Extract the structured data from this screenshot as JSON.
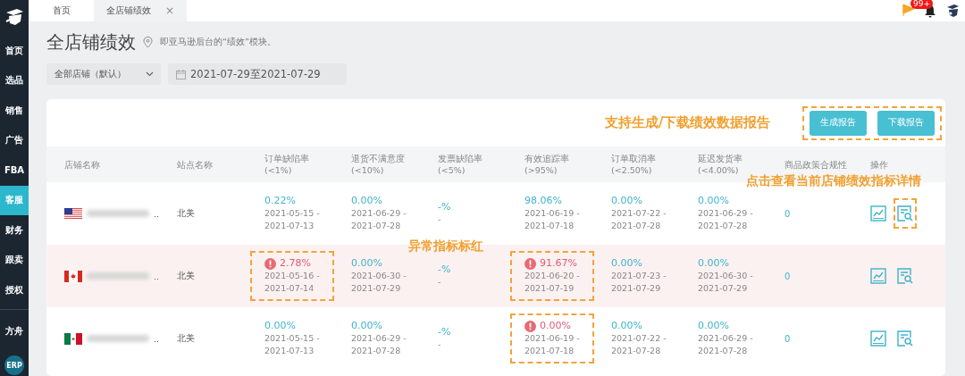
{
  "sidebar": {
    "items": [
      {
        "label": "首页",
        "selected": false
      },
      {
        "label": "选品",
        "selected": false
      },
      {
        "label": "销售",
        "selected": false
      },
      {
        "label": "广告",
        "selected": false
      },
      {
        "label": "FBA",
        "selected": false
      },
      {
        "label": "客服",
        "selected": true
      },
      {
        "label": "财务",
        "selected": false
      },
      {
        "label": "跟卖",
        "selected": false
      },
      {
        "label": "授权",
        "selected": false
      }
    ],
    "bottom_items": [
      {
        "label": "方舟",
        "kind": "text"
      },
      {
        "label": "ERP",
        "kind": "circle"
      }
    ]
  },
  "tabs": [
    {
      "label": "首页",
      "selected": false
    },
    {
      "label": "全店铺绩效",
      "selected": true,
      "close": "×"
    }
  ],
  "notifications": {
    "badge": "99+"
  },
  "page": {
    "title": "全店铺绩效",
    "hint": "即亚马逊后台的“绩效”模块。",
    "store_filter": "全部店铺（默认）",
    "date_range": "2021-07-29至2021-07-29"
  },
  "toolbar": {
    "note": "支持生成/下载绩效数据报告",
    "buttons": [
      "生成报告",
      "下载报告"
    ]
  },
  "table": {
    "columns": [
      {
        "label": "店铺名称"
      },
      {
        "label": "站点名称"
      },
      {
        "label": "订单缺陷率",
        "sub": "(<1%)"
      },
      {
        "label": "退货不满意度",
        "sub": "(<10%)"
      },
      {
        "label": "发票缺陷率",
        "sub": "(<5%)"
      },
      {
        "label": "有效追踪率",
        "sub": "(>95%)"
      },
      {
        "label": "订单取消率",
        "sub": "(<2.50%)"
      },
      {
        "label": "延迟发货率",
        "sub": "(<4.00%)"
      },
      {
        "label": "商品政策合规性"
      },
      {
        "label": "操作"
      }
    ],
    "rows": [
      {
        "kind": "us",
        "name_suffix": "..",
        "site": "北美",
        "highlighted": false,
        "compliance": "0",
        "detail_marked": true,
        "metrics": [
          {
            "value": "0.22%",
            "dates": [
              "2021-05-15 -",
              "2021-07-13"
            ],
            "alert": false
          },
          {
            "value": "0.00%",
            "dates": [
              "2021-06-29 -",
              "2021-07-28"
            ],
            "alert": false
          },
          {
            "value": "-%",
            "dates": [
              "-"
            ],
            "alert": false
          },
          {
            "value": "98.06%",
            "dates": [
              "2021-06-19 -",
              "2021-07-18"
            ],
            "alert": false
          },
          {
            "value": "0.00%",
            "dates": [
              "2021-07-22 -",
              "2021-07-28"
            ],
            "alert": false
          },
          {
            "value": "0.00%",
            "dates": [
              "2021-06-29 -",
              "2021-07-28"
            ],
            "alert": false
          }
        ]
      },
      {
        "kind": "ca",
        "name_suffix": "..",
        "site": "北美",
        "highlighted": true,
        "compliance": "0",
        "detail_marked": false,
        "metrics": [
          {
            "value": "2.78%",
            "dates": [
              "2021-05-16 -",
              "2021-07-14"
            ],
            "alert": true
          },
          {
            "value": "0.00%",
            "dates": [
              "2021-06-30 -",
              "2021-07-29"
            ],
            "alert": false
          },
          {
            "value": "-%",
            "dates": [
              "-"
            ],
            "alert": false
          },
          {
            "value": "91.67%",
            "dates": [
              "2021-06-20 -",
              "2021-07-19"
            ],
            "alert": true
          },
          {
            "value": "0.00%",
            "dates": [
              "2021-07-23 -",
              "2021-07-29"
            ],
            "alert": false
          },
          {
            "value": "0.00%",
            "dates": [
              "2021-06-30 -",
              "2021-07-29"
            ],
            "alert": false
          }
        ]
      },
      {
        "kind": "mx",
        "name_suffix": "..",
        "site": "北美",
        "highlighted": false,
        "compliance": "0",
        "detail_marked": false,
        "metrics": [
          {
            "value": "0.00%",
            "dates": [
              "2021-05-15 -",
              "2021-07-13"
            ],
            "alert": false
          },
          {
            "value": "0.00%",
            "dates": [
              "2021-06-29 -",
              "2021-07-28"
            ],
            "alert": false
          },
          {
            "value": "-%",
            "dates": [
              "-"
            ],
            "alert": false
          },
          {
            "value": "0.00%",
            "dates": [
              "2021-06-19 -",
              "2021-07-18"
            ],
            "alert": true
          },
          {
            "value": "0.00%",
            "dates": [
              "2021-07-22 -",
              "2021-07-28"
            ],
            "alert": false
          },
          {
            "value": "0.00%",
            "dates": [
              "2021-06-29 -",
              "2021-07-28"
            ],
            "alert": false
          }
        ]
      }
    ]
  },
  "annotations": {
    "alert_note": "异常指标标红",
    "detail_note": "点击查看当前店铺绩效指标详情"
  }
}
